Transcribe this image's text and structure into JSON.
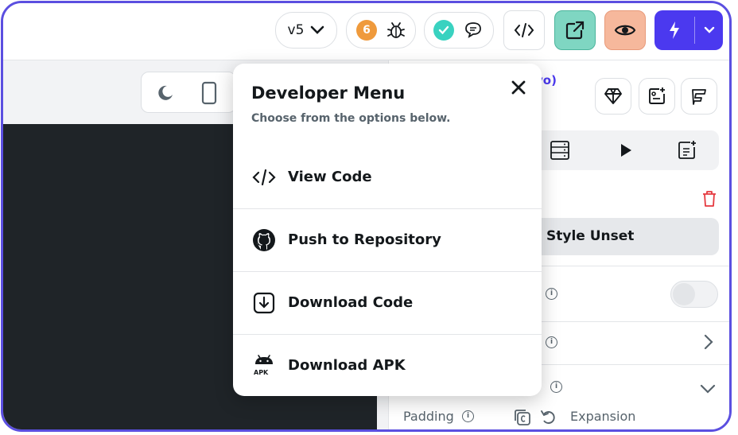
{
  "topbar": {
    "version_label": "v5",
    "issues_count": "6"
  },
  "right_panel": {
    "header_fragment": "vo)",
    "style_button": "Style Unset",
    "padding_label": "Padding",
    "expansion_label": "Expansion"
  },
  "developer_menu": {
    "title": "Developer Menu",
    "subtitle": "Choose from the options below.",
    "items": [
      {
        "label": "View Code",
        "icon": "code-icon"
      },
      {
        "label": "Push to Repository",
        "icon": "github-icon"
      },
      {
        "label": "Download Code",
        "icon": "download-icon"
      },
      {
        "label": "Download APK",
        "icon": "android-apk-icon"
      }
    ],
    "apk_badge": "APK"
  },
  "colors": {
    "accent": "#4b39ef",
    "frame": "#5b4fe0",
    "issues_badge": "#ef9a3c",
    "check_badge": "#39d2c0",
    "export_bg": "#7fd6c2",
    "preview_bg": "#f6b89c",
    "canvas": "#1f2428",
    "delete": "#e5393f"
  }
}
